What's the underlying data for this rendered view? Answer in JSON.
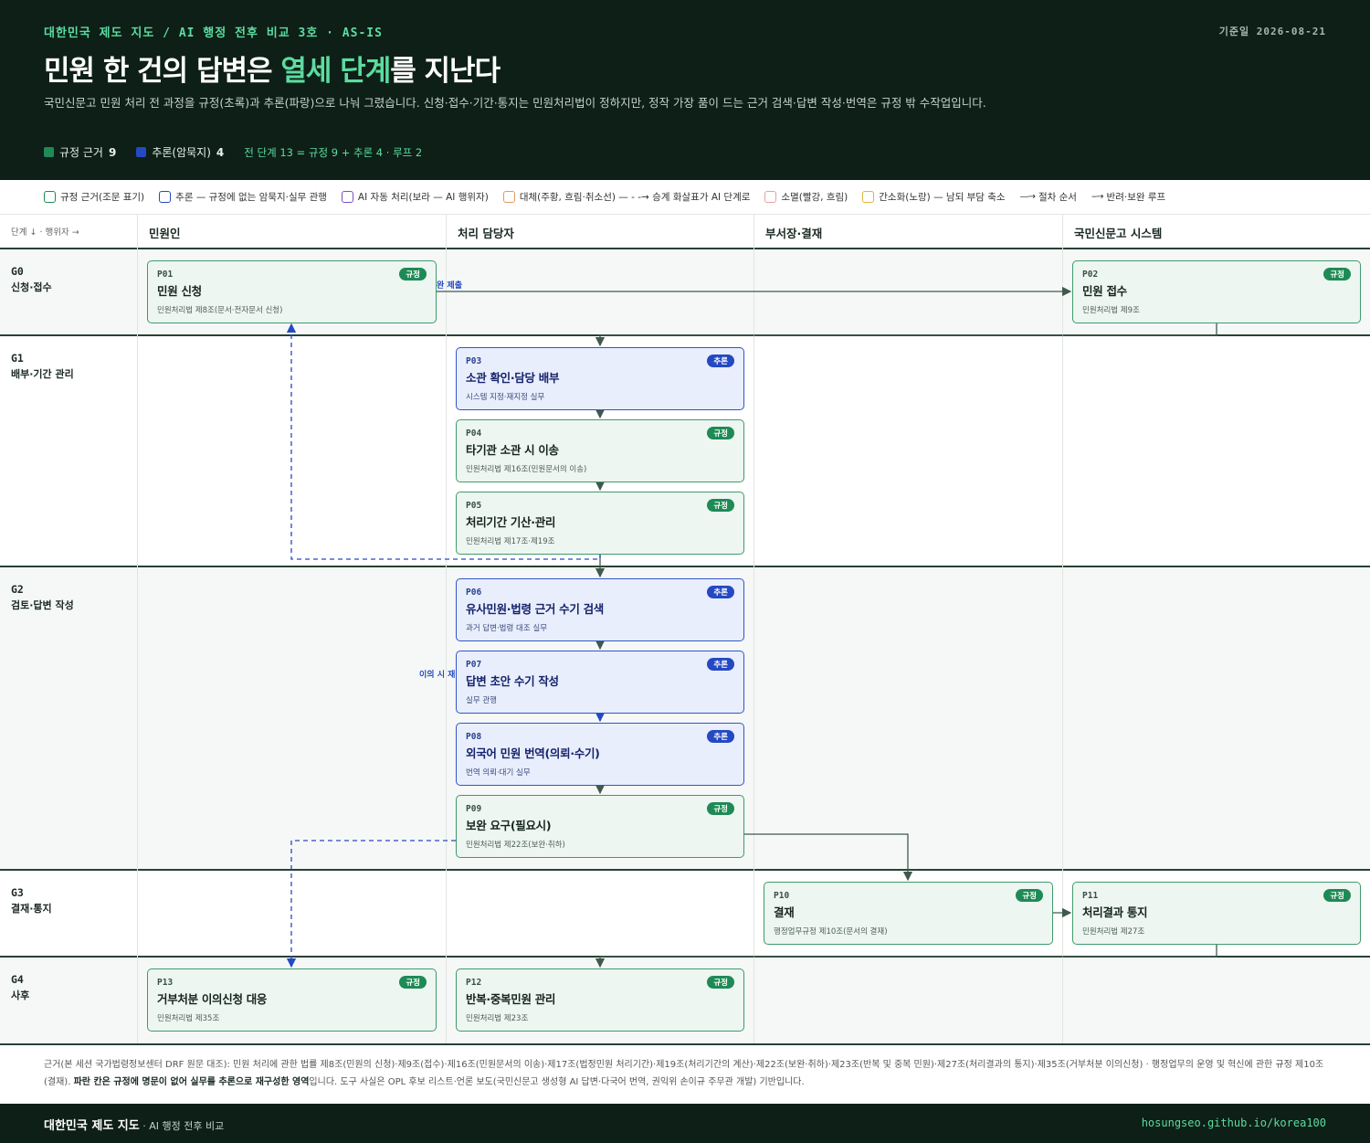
{
  "header": {
    "kicker": "대한민국 제도 지도 / AI 행정 전후 비교 3호 · AS-IS",
    "date": "기준일 2026-08-21",
    "title_pre": "민원 한 건의 답변은 ",
    "title_hl": "열세 단계",
    "title_post": "를 지난다",
    "subtitle": "국민신문고 민원 처리 전 과정을 규정(초록)과 추론(파랑)으로 나눠 그렸습니다. 신청·접수·기간·통지는 민원처리법이 정하지만, 정작 가장 품이 드는 근거 검색·답변 작성·번역은 규정 밖 수작업입니다.",
    "stat_rule_label": "규정 근거",
    "stat_rule_count": "9",
    "stat_infer_label": "추론(암묵지)",
    "stat_infer_count": "4",
    "stat_sum": "전 단계 13 = 규정 9 + 추론 4 · 루프 2",
    "colors": {
      "rule": "#1e8a55",
      "infer": "#2549c2",
      "accent": "#5ddba0",
      "dark": "#0d1f16"
    }
  },
  "legend": {
    "rule": "규정 근거(조문 표기)",
    "infer": "추론 — 규정에 없는 암묵지·실무 관행",
    "ai": "AI 자동 처리(보라 — AI 행위자)",
    "replace": "대체(주황, 흐림·취소선) — - -→ 승계 화살표가 AI 단계로",
    "remove": "소멸(빨강, 흐림)",
    "simplify": "간소화(노랑) — 남되 부담 축소",
    "flow": "절차 순서",
    "loop": "반려·보완 루프"
  },
  "lanes": {
    "corner": "단계 ↓ · 행위자 →",
    "citizen": "민원인",
    "officer": "처리 담당자",
    "manager": "부서장·결재",
    "system": "국민신문고 시스템"
  },
  "stages": [
    {
      "id": "G0",
      "name": "신청·접수"
    },
    {
      "id": "G1",
      "name": "배부·기간 관리"
    },
    {
      "id": "G2",
      "name": "검토·답변 작성"
    },
    {
      "id": "G3",
      "name": "결재·통지"
    },
    {
      "id": "G4",
      "name": "사후"
    }
  ],
  "nodes": {
    "P01": {
      "id": "P01",
      "title": "민원 신청",
      "ref": "민원처리법 제8조(문서·전자문서 신청)",
      "badge": "규정"
    },
    "P02": {
      "id": "P02",
      "title": "민원 접수",
      "ref": "민원처리법 제9조",
      "badge": "규정"
    },
    "P03": {
      "id": "P03",
      "title": "소관 확인·담당 배부",
      "ref": "시스템 지정·재지정 실무",
      "badge": "추론"
    },
    "P04": {
      "id": "P04",
      "title": "타기관 소관 시 이송",
      "ref": "민원처리법 제16조(민원문서의 이송)",
      "badge": "규정"
    },
    "P05": {
      "id": "P05",
      "title": "처리기간 기산·관리",
      "ref": "민원처리법 제17조·제19조",
      "badge": "규정"
    },
    "P06": {
      "id": "P06",
      "title": "유사민원·법령 근거 수기 검색",
      "ref": "과거 답변·법령 대조 실무",
      "badge": "추론"
    },
    "P07": {
      "id": "P07",
      "title": "답변 초안 수기 작성",
      "ref": "실무 관행",
      "badge": "추론"
    },
    "P08": {
      "id": "P08",
      "title": "외국어 민원 번역(의뢰·수기)",
      "ref": "번역 의뢰·대기 실무",
      "badge": "추론"
    },
    "P09": {
      "id": "P09",
      "title": "보완 요구(필요시)",
      "ref": "민원처리법 제22조(보완·취하)",
      "badge": "규정"
    },
    "P10": {
      "id": "P10",
      "title": "결재",
      "ref": "행정업무규정 제10조(문서의 결재)",
      "badge": "규정"
    },
    "P11": {
      "id": "P11",
      "title": "처리결과 통지",
      "ref": "민원처리법 제27조",
      "badge": "규정"
    },
    "P12": {
      "id": "P12",
      "title": "반복·중복민원 관리",
      "ref": "민원처리법 제23조",
      "badge": "규정"
    },
    "P13": {
      "id": "P13",
      "title": "거부처분 이의신청 대응",
      "ref": "민원처리법 제35조",
      "badge": "규정"
    }
  },
  "edge_labels": {
    "submit": "완 제출",
    "objection": "이의 시 재"
  },
  "notes": {
    "text1": "근거(본 세션 국가법령정보센터 DRF 원문 대조): 민원 처리에 관한 법률 제8조(민원의 신청)·제9조(접수)·제16조(민원문서의 이송)·제17조(법정민원 처리기간)·제19조(처리기간의 계산)·제22조(보완·취하)·제23조(반복 및 중복 민원)·제27조(처리결과의 통지)·제35조(거부처분 이의신청) · 행정업무의 운영 및 혁신에 관한 규정 제10조(결재). ",
    "bold": "파란 칸은 규정에 명문이 없어 실무를 추론으로 재구성한 영역",
    "text2": "입니다. 도구 사실은 OPL 후보 리스트·언론 보도(국민신문고 생성형 AI 답변·다국어 번역, 권익위 손이규 주무관 개발) 기반입니다."
  },
  "footer": {
    "brand": "대한민국 제도 지도",
    "brand_sub": " · AI 행정 전후 비교",
    "url": "hosungseo.github.io/korea100"
  }
}
